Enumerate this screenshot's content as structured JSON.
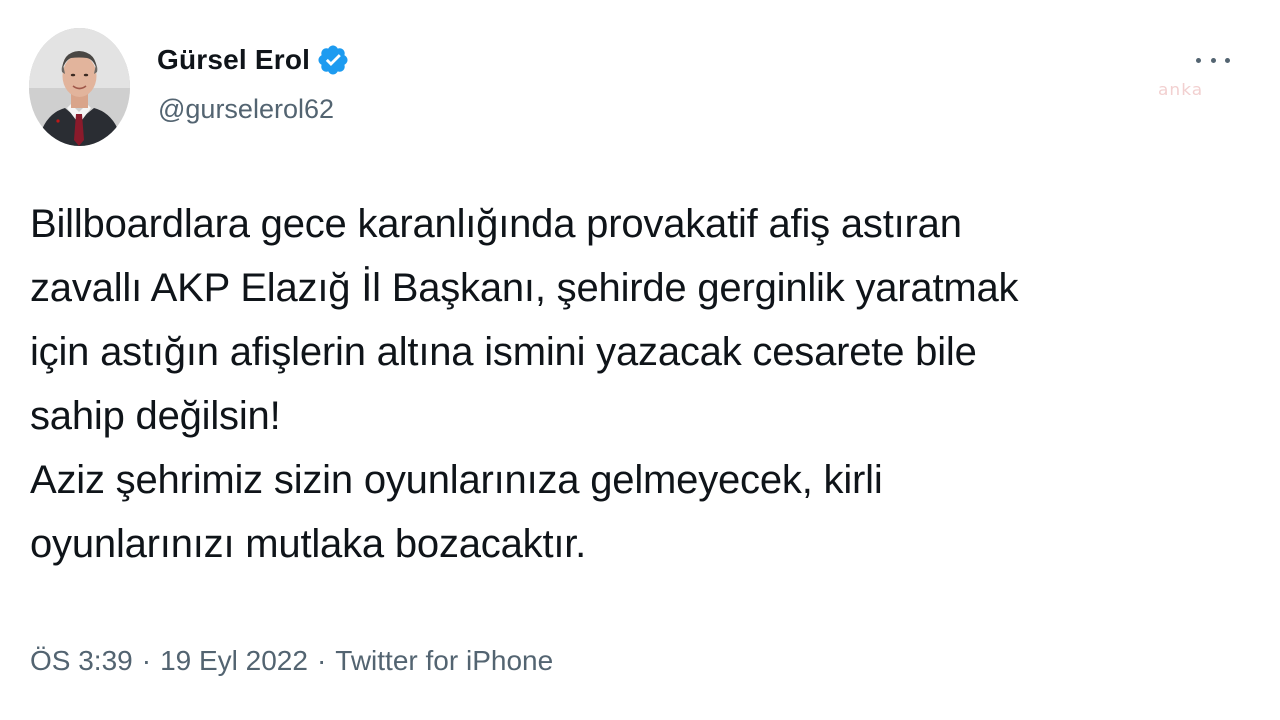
{
  "watermark": "anka",
  "author": {
    "display_name": "Gürsel Erol",
    "handle": "@gurselerol62",
    "verified": true
  },
  "tweet": {
    "lines": [
      "Billboardlara gece karanlığında provakatif afiş astıran",
      "zavallı AKP Elazığ İl Başkanı, şehirde gerginlik yaratmak",
      "için astığın afişlerin altına ismini yazacak cesarete bile",
      "sahip değilsin!",
      "Aziz şehrimiz sizin oyunlarınıza gelmeyecek, kirli",
      "oyunlarınızı mutlaka bozacaktır."
    ]
  },
  "meta": {
    "time": "ÖS 3:39",
    "separator": "·",
    "date": "19 Eyl 2022",
    "source": "Twitter for iPhone"
  },
  "colors": {
    "text": "#0f1419",
    "secondary": "#536471",
    "verified_badge": "#1d9bf0"
  },
  "icons": {
    "verified": "verified-badge-icon",
    "more": "more-options-icon"
  }
}
